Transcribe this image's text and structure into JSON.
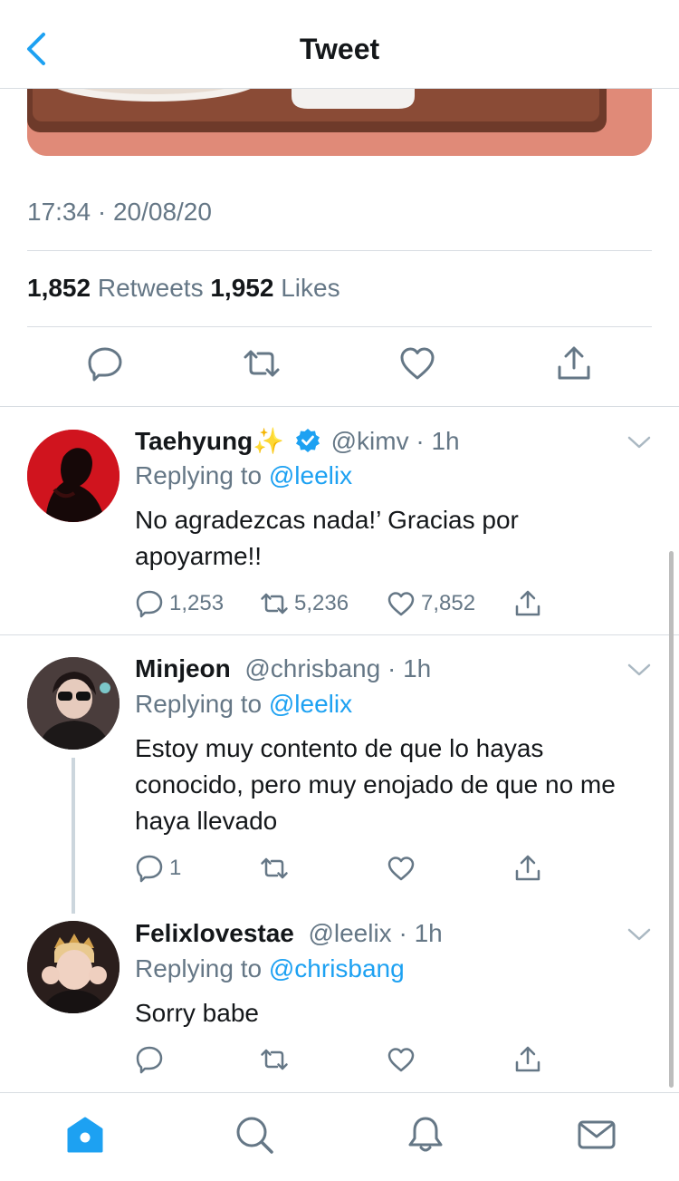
{
  "header": {
    "title": "Tweet"
  },
  "tweet": {
    "timestamp": "17:34 · 20/08/20",
    "retweet_count": "1,852",
    "retweet_label": "Retweets",
    "like_count": "1,952",
    "like_label": "Likes"
  },
  "replies": [
    {
      "name": "Taehyung",
      "name_emoji": "✨",
      "verified": true,
      "handle": "@kimv",
      "time": "1h",
      "replying_label": "Replying to",
      "replying_to": "@leelix",
      "text": "No agradezcas nada!’ Gracias por apoyarme!!",
      "reply_count": "1,253",
      "retweet_count": "5,236",
      "like_count": "7,852"
    },
    {
      "name": "Minjeon",
      "handle": "@chrisbang",
      "time": "1h",
      "replying_label": "Replying to",
      "replying_to": "@leelix",
      "text": "Estoy muy contento de que lo hayas conocido, pero muy enojado de que no me haya llevado",
      "reply_count": "1",
      "retweet_count": "",
      "like_count": ""
    },
    {
      "name": "Felixlovestae",
      "handle": "@leelix",
      "time": "1h",
      "replying_label": "Replying to",
      "replying_to": "@chrisbang",
      "text": "Sorry babe",
      "reply_count": "",
      "retweet_count": "",
      "like_count": ""
    }
  ],
  "tabs": [
    "home-tab",
    "search-tab",
    "notifications-tab",
    "messages-tab"
  ],
  "colors": {
    "accent": "#1da1f2",
    "muted": "#657786",
    "text": "#14171a",
    "divider": "#d8dde2"
  }
}
